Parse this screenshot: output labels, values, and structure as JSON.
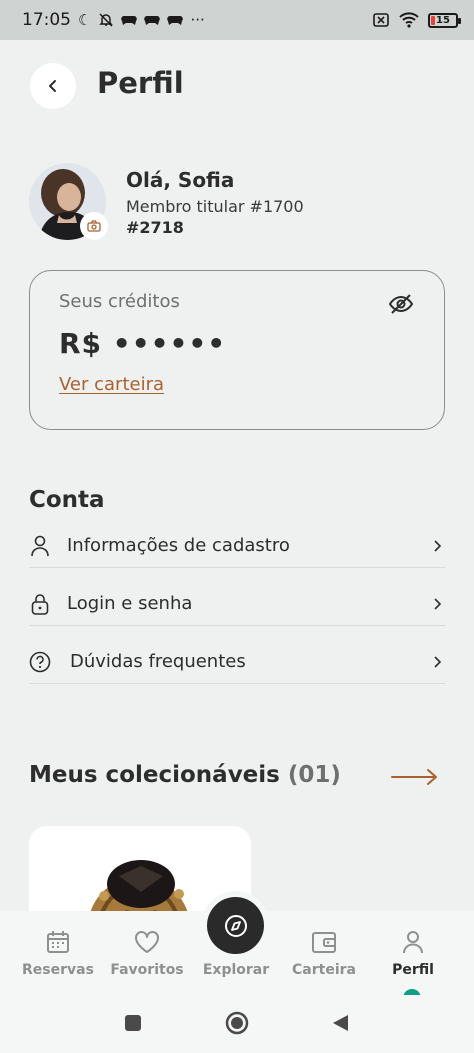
{
  "status_bar": {
    "time": "17:05",
    "left_icons": [
      "moon-icon",
      "bell-off-icon",
      "game-controller-icon",
      "game-controller-icon",
      "game-controller-icon",
      "more-dots-icon"
    ],
    "right_icons": [
      "sim-off-icon",
      "wifi-icon",
      "battery-icon"
    ],
    "battery_level": "15",
    "battery_color": "#e4433a"
  },
  "header": {
    "title": "Perfil",
    "back_icon": "chevron-left-icon"
  },
  "profile": {
    "greeting": "Olá, Sofia",
    "member_line": "Membro titular #1700",
    "member_number": "#2718",
    "avatar_badge_icon": "camera-icon"
  },
  "credits": {
    "label": "Seus créditos",
    "value": "R$ ••••••",
    "toggle_icon": "eye-off-icon",
    "wallet_link": "Ver carteira",
    "link_color": "#a9622f"
  },
  "account": {
    "title": "Conta",
    "items": [
      {
        "label": "Informações de cadastro",
        "icon": "user-icon"
      },
      {
        "label": "Login e senha",
        "icon": "lock-icon"
      },
      {
        "label": "Dúvidas frequentes",
        "icon": "help-circle-icon"
      }
    ]
  },
  "collectibles": {
    "title": "Meus colecionáveis",
    "count": "(01)",
    "arrow_icon": "arrow-right-icon"
  },
  "tabbar": {
    "tabs": [
      {
        "label": "Reservas",
        "icon": "calendar-icon"
      },
      {
        "label": "Favoritos",
        "icon": "heart-icon"
      },
      {
        "label": "Explorar",
        "icon": "compass-icon"
      },
      {
        "label": "Carteira",
        "icon": "wallet-icon"
      },
      {
        "label": "Perfil",
        "icon": "user-icon"
      }
    ],
    "active": "Perfil",
    "accent": "#129e84"
  },
  "system_nav": {
    "buttons": [
      "recent-apps-icon",
      "home-icon",
      "back-icon"
    ]
  }
}
